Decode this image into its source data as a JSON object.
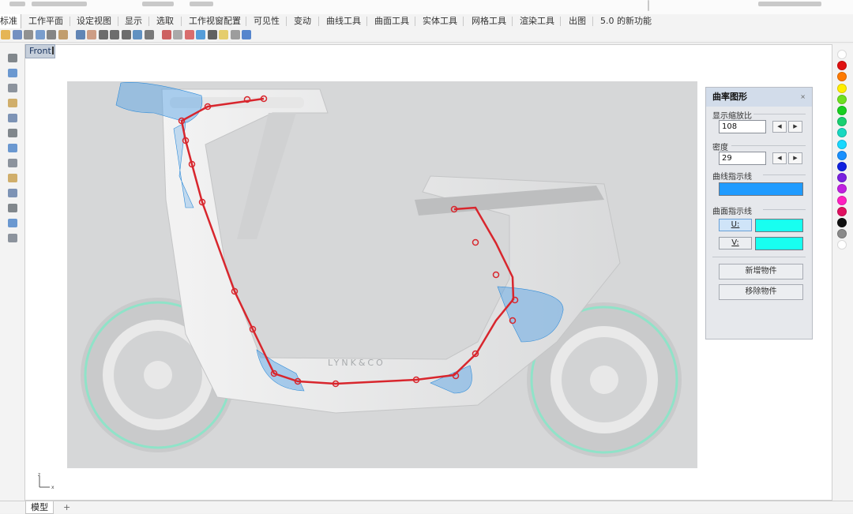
{
  "menu_tabs": [
    "标准",
    "工作平面",
    "设定视图",
    "显示",
    "选取",
    "工作视窗配置",
    "可见性",
    "变动",
    "曲线工具",
    "曲面工具",
    "实体工具",
    "网格工具",
    "渲染工具",
    "出图",
    "5.0 的新功能"
  ],
  "toolbar_icons": [
    "open-file-icon",
    "save-file-icon",
    "print-icon",
    "copy-icon",
    "cut-icon",
    "paste-icon",
    "undo-icon",
    "pan-hand-icon",
    "zoom-icon",
    "zoom-window-icon",
    "zoom-extents-icon",
    "rotate-view-icon",
    "four-views-icon",
    "camera-icon",
    "shade-icon",
    "render-sphere-icon",
    "material-sphere-icon",
    "render-icon",
    "light-icon",
    "options-icon",
    "help-icon"
  ],
  "left_tool_icons": [
    "point-icon",
    "polyline-icon",
    "circle-icon",
    "rectangle-icon",
    "curve-icon",
    "surface-icon",
    "solid-icon",
    "mesh-icon",
    "transform-icon",
    "boolean-icon",
    "dimension-icon",
    "analyze-icon",
    "render-tool-icon"
  ],
  "viewport": {
    "label": "Front"
  },
  "axis_indicator": {
    "z": "z",
    "x": "x"
  },
  "bottom_tabs": {
    "model": "模型",
    "add": "+"
  },
  "colors": [
    "#ffffff",
    "#e01010",
    "#ff7a00",
    "#ffee00",
    "#6ee020",
    "#18d020",
    "#18d070",
    "#18d8c0",
    "#18d8ff",
    "#1890ff",
    "#1020e0",
    "#7a20e0",
    "#c020e0",
    "#ff20c0",
    "#e01060",
    "#101010",
    "#8a8a8a",
    "#ffffff"
  ],
  "curvature_panel": {
    "title": "曲率图形",
    "close": "×",
    "scale_label": "显示缩放比",
    "scale_value": "108",
    "density_label": "密度",
    "density_value": "29",
    "spin_left": "◀",
    "spin_right": "▶",
    "curve_hair_label": "曲线指示线",
    "curve_hair_color": "#1f9bff",
    "surface_hair_label": "曲面指示线",
    "u_label": "U:",
    "v_label": "V:",
    "u_color": "#18fff0",
    "v_color": "#18fff0",
    "add_button": "新增物件",
    "remove_button": "移除物件"
  },
  "photo_logo": "LYNK&CO"
}
